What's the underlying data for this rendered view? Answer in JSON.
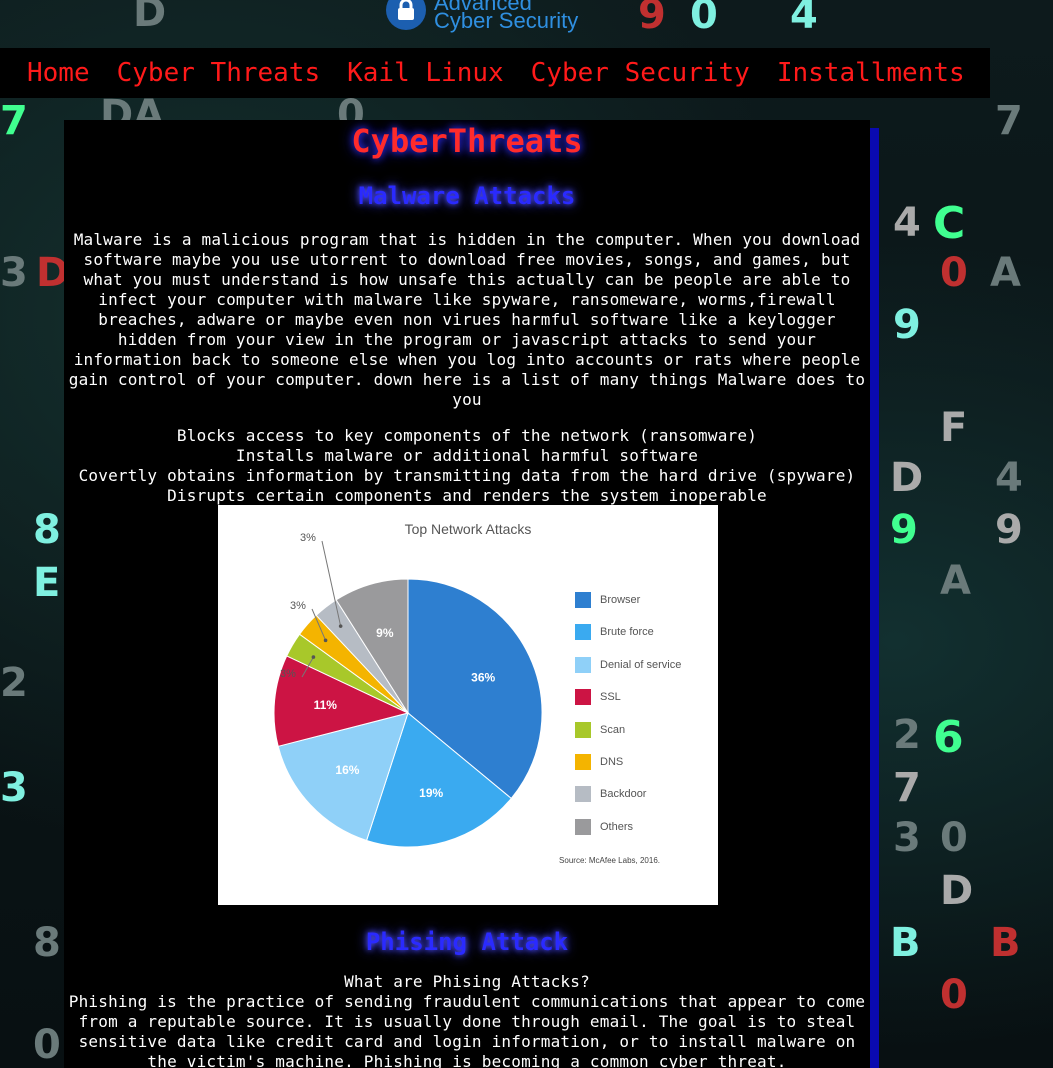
{
  "brand": {
    "line1": "Advanced",
    "line2": "Cyber Security"
  },
  "nav": {
    "items": [
      {
        "label": "Home"
      },
      {
        "label": "Cyber Threats"
      },
      {
        "label": "Kail Linux"
      },
      {
        "label": "Cyber Security"
      },
      {
        "label": "Installments"
      }
    ]
  },
  "page": {
    "title": "CyberThreats",
    "malware": {
      "heading": "Malware Attacks",
      "intro": "Malware is a malicious program that is hidden in the computer. When you download software maybe you use utorrent to download free movies, songs, and games, but what you must understand is how unsafe this actually can be people are able to infect your computer with malware like spyware, ransomeware, worms,firewall breaches, adware or maybe even non virues harmful software like a keylogger hidden from your view in the program or javascript attacks to send your information back to someone else when you log into accounts or rats where people gain control of your computer. down here is a list of many things Malware does to you",
      "list": [
        "Blocks access to key components of the network (ransomware)",
        "Installs malware or additional harmful software",
        "Covertly obtains information by transmitting data from the hard drive (spyware)",
        "Disrupts certain components and renders the system inoperable"
      ]
    },
    "phishing": {
      "heading": "Phising Attack",
      "question": "What are Phising Attacks?",
      "text": "Phishing is the practice of sending fraudulent communications that appear to come from a reputable source. It is usually done through email. The goal is to steal sensitive data like credit card and login information, or to install malware on the victim's machine. Phishing is becoming a common cyber threat."
    }
  },
  "chart_data": {
    "type": "pie",
    "title": "Top Network Attacks",
    "source": "Source: McAfee Labs, 2016.",
    "categories": [
      "Browser",
      "Brute force",
      "Denial of service",
      "SSL",
      "Scan",
      "DNS",
      "Backdoor",
      "Others"
    ],
    "values": [
      36,
      19,
      16,
      11,
      3,
      3,
      3,
      9
    ],
    "labels": [
      "36%",
      "19%",
      "16%",
      "11%",
      "3%",
      "3%",
      "3%",
      "9%"
    ],
    "colors": [
      "#2e7fd0",
      "#3aaaf0",
      "#8fd0f8",
      "#cc1444",
      "#a8c82a",
      "#f4b400",
      "#b6bcc4",
      "#9a9a9c"
    ],
    "legend_position": "right"
  },
  "colors": {
    "nav_text": "#ff1a1a",
    "title": "#ff2b2b",
    "heading": "#2a2aff",
    "sidebar_bar": "#0a0ab0"
  }
}
